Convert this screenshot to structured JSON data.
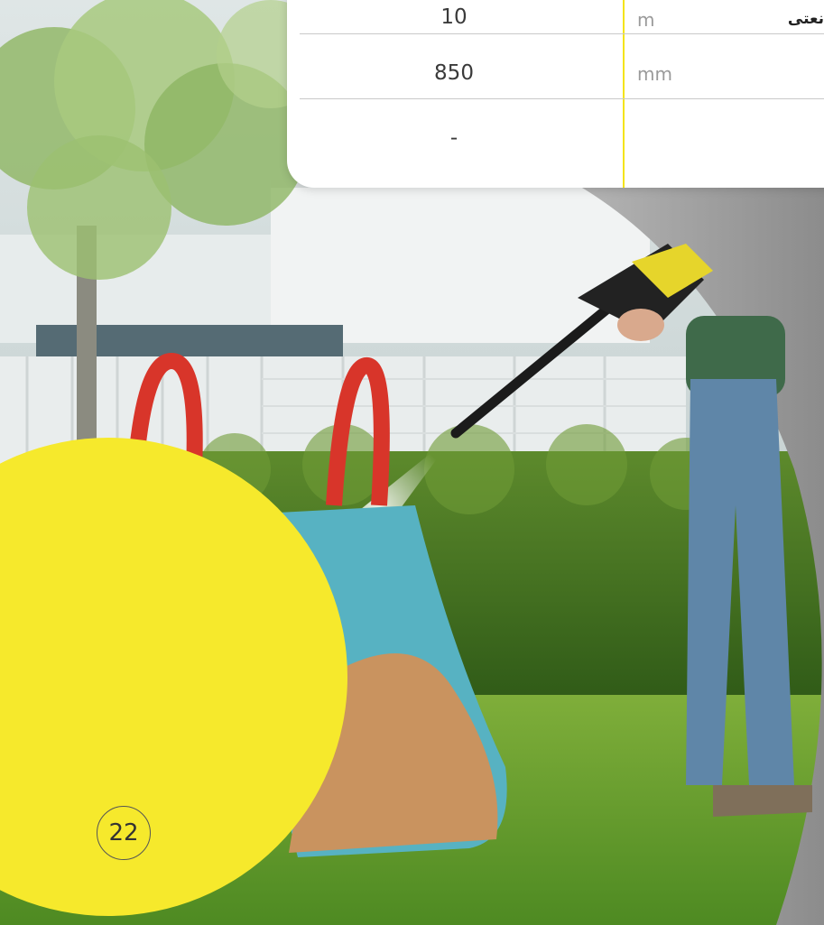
{
  "spec_table": {
    "rows": [
      {
        "value": "10",
        "unit": "m",
        "label": "نعتی"
      },
      {
        "value": "850",
        "unit": "mm",
        "label": ""
      },
      {
        "value": "-",
        "unit": "",
        "label": ""
      }
    ]
  },
  "page_number": "22",
  "colors": {
    "accent_yellow": "#f6e92c",
    "gray_panel": "#9c9c9c",
    "divider_yellow": "#f4e318"
  }
}
